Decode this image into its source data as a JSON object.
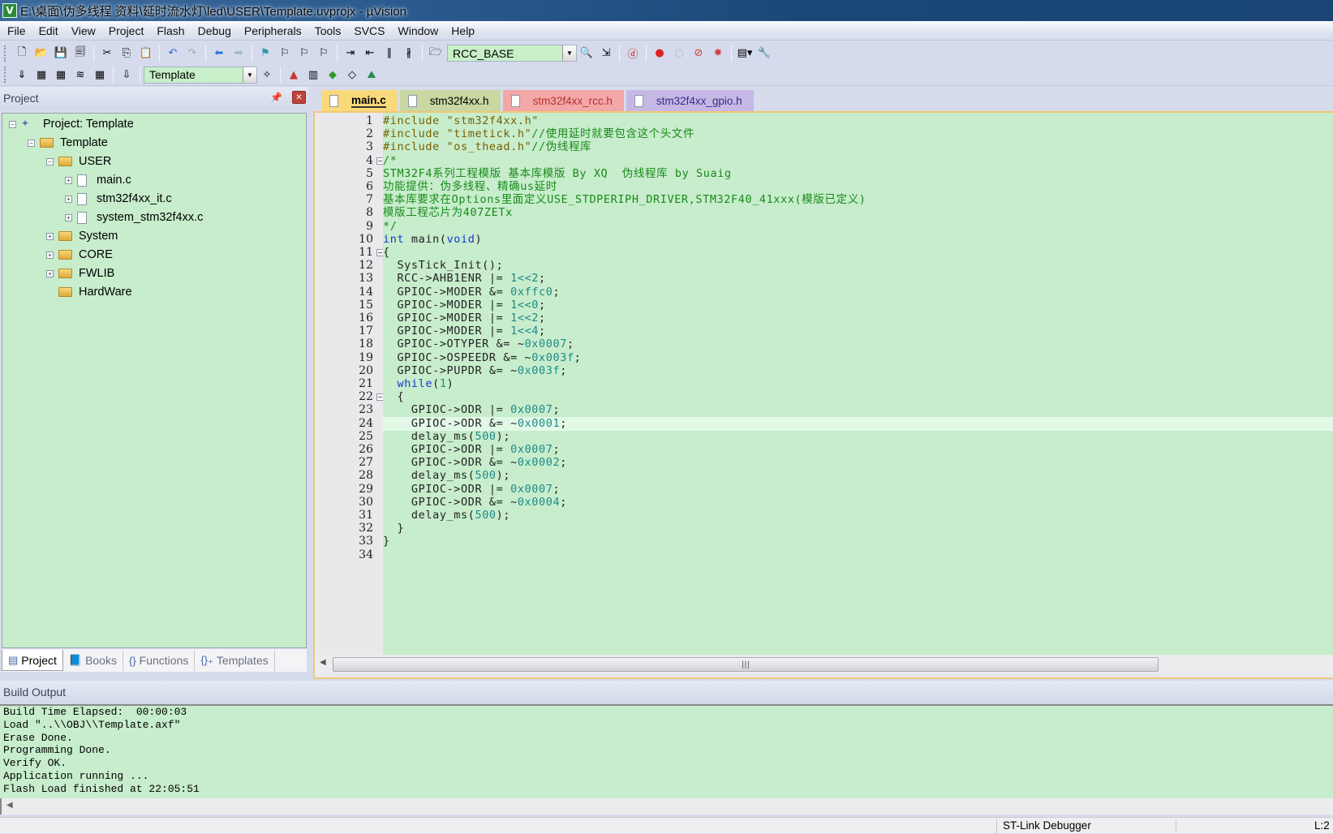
{
  "window": {
    "title": "E:\\桌面\\伪多线程 资料\\延时流水灯\\led\\USER\\Template.uvprojx - µVision",
    "app_icon": "uvision-icon"
  },
  "menu": [
    "File",
    "Edit",
    "View",
    "Project",
    "Flash",
    "Debug",
    "Peripherals",
    "Tools",
    "SVCS",
    "Window",
    "Help"
  ],
  "toolbar1": {
    "groups": [
      [
        "new-file-icon",
        "open-file-icon",
        "save-icon",
        "save-all-icon"
      ],
      [
        "cut-icon",
        "copy-icon",
        "paste-icon"
      ],
      [
        "undo-icon",
        "redo-icon"
      ],
      [
        "nav-back-icon",
        "nav-forward-icon"
      ],
      [
        "bookmark-icon",
        "prev-bookmark-icon",
        "next-bookmark-icon",
        "clear-bookmarks-icon"
      ],
      [
        "indent-icon",
        "unindent-icon",
        "comment-icon",
        "uncomment-icon"
      ]
    ],
    "find_combo_value": "RCC_BASE",
    "after_combo": [
      "find-in-files-icon",
      "incremental-find-icon",
      "debug-session-icon",
      "breakpoint-icon",
      "disable-breakpoint-icon",
      "kill-breakpoints-icon",
      "kill-all-breakpoints-icon",
      "window-layout-icon",
      "configure-icon"
    ]
  },
  "toolbar2": {
    "buttons": [
      "translate-icon",
      "build-icon",
      "rebuild-icon",
      "batch-build-icon",
      "stop-build-icon",
      "load-icon"
    ],
    "target_combo_value": "Template",
    "after_combo": [
      "target-options-icon",
      "manage-components-icon",
      "select-packs-icon",
      "pack-installer-icon",
      "event-recorder-icon",
      "rte-icon"
    ]
  },
  "project_panel": {
    "title": "Project",
    "tree": [
      {
        "label": "Project: Template",
        "level": 0,
        "kind": "project",
        "expander": "-"
      },
      {
        "label": "Template",
        "level": 1,
        "kind": "target",
        "expander": "-"
      },
      {
        "label": "USER",
        "level": 2,
        "kind": "folder-open",
        "expander": "-"
      },
      {
        "label": "main.c",
        "level": 3,
        "kind": "file",
        "expander": "+"
      },
      {
        "label": "stm32f4xx_it.c",
        "level": 3,
        "kind": "file",
        "expander": "+"
      },
      {
        "label": "system_stm32f4xx.c",
        "level": 3,
        "kind": "file",
        "expander": "+"
      },
      {
        "label": "System",
        "level": 2,
        "kind": "folder",
        "expander": "+"
      },
      {
        "label": "CORE",
        "level": 2,
        "kind": "folder",
        "expander": "+"
      },
      {
        "label": "FWLIB",
        "level": 2,
        "kind": "folder",
        "expander": "+"
      },
      {
        "label": "HardWare",
        "level": 2,
        "kind": "folder-open",
        "expander": ""
      }
    ],
    "tabs": [
      {
        "label": "Project",
        "icon": "project-tab-icon",
        "active": true
      },
      {
        "label": "Books",
        "icon": "books-icon",
        "active": false
      },
      {
        "label": "Functions",
        "icon": "{}",
        "active": false
      },
      {
        "label": "Templates",
        "icon": "templates-icon",
        "active": false
      }
    ]
  },
  "editor": {
    "tabs": [
      {
        "label": "main.c",
        "active": true
      },
      {
        "label": "stm32f4xx.h",
        "active": false
      },
      {
        "label": "stm32f4xx_rcc.h",
        "active": false
      },
      {
        "label": "stm32f4xx_gpio.h",
        "active": false
      }
    ],
    "current_line": 24,
    "fold_lines": {
      "4": "-",
      "11": "-",
      "22": "-"
    },
    "lines": [
      [
        [
          "pp",
          "#include "
        ],
        [
          "st",
          "\"stm32f4xx.h\""
        ]
      ],
      [
        [
          "pp",
          "#include "
        ],
        [
          "st",
          "\"timetick.h\""
        ],
        [
          "cm",
          "//使用延时就要包含这个头文件"
        ]
      ],
      [
        [
          "pp",
          "#include "
        ],
        [
          "st",
          "\"os_thead.h\""
        ],
        [
          "cm",
          "//伪线程库"
        ]
      ],
      [
        [
          "cm",
          "/*"
        ]
      ],
      [
        [
          "cm",
          "STM32F4系列工程模版 基本库模版 By XQ  伪线程库 by Suaig"
        ]
      ],
      [
        [
          "cm",
          "功能提供：伪多线程、精确us延时"
        ]
      ],
      [
        [
          "cm",
          "基本库要求在Options里面定义USE_STDPERIPH_DRIVER,STM32F40_41xxx(模版已定义)"
        ]
      ],
      [
        [
          "cm",
          "模版工程芯片为407ZETx"
        ]
      ],
      [
        [
          "cm",
          "*/"
        ]
      ],
      [
        [
          "kw",
          "int"
        ],
        [
          "t",
          " main("
        ],
        [
          "kw",
          "void"
        ],
        [
          "t",
          ")"
        ]
      ],
      [
        [
          "t",
          "{"
        ]
      ],
      [
        [
          "t",
          "  SysTick_Init();"
        ]
      ],
      [
        [
          "t",
          "  RCC->AHB1ENR |= "
        ],
        [
          "nm",
          "1<<2"
        ],
        [
          "t",
          ";"
        ]
      ],
      [
        [
          "t",
          "  GPIOC->MODER &= "
        ],
        [
          "nm",
          "0xffc0"
        ],
        [
          "t",
          ";"
        ]
      ],
      [
        [
          "t",
          "  GPIOC->MODER |= "
        ],
        [
          "nm",
          "1<<0"
        ],
        [
          "t",
          ";"
        ]
      ],
      [
        [
          "t",
          "  GPIOC->MODER |= "
        ],
        [
          "nm",
          "1<<2"
        ],
        [
          "t",
          ";"
        ]
      ],
      [
        [
          "t",
          "  GPIOC->MODER |= "
        ],
        [
          "nm",
          "1<<4"
        ],
        [
          "t",
          ";"
        ]
      ],
      [
        [
          "t",
          "  GPIOC->OTYPER &= ~"
        ],
        [
          "nm",
          "0x0007"
        ],
        [
          "t",
          ";"
        ]
      ],
      [
        [
          "t",
          "  GPIOC->OSPEEDR &= ~"
        ],
        [
          "nm",
          "0x003f"
        ],
        [
          "t",
          ";"
        ]
      ],
      [
        [
          "t",
          "  GPIOC->PUPDR &= ~"
        ],
        [
          "nm",
          "0x003f"
        ],
        [
          "t",
          ";"
        ]
      ],
      [
        [
          "t",
          "  "
        ],
        [
          "kw",
          "while"
        ],
        [
          "t",
          "("
        ],
        [
          "nm",
          "1"
        ],
        [
          "t",
          ")"
        ]
      ],
      [
        [
          "t",
          "  {"
        ]
      ],
      [
        [
          "t",
          "    GPIOC->ODR |= "
        ],
        [
          "nm",
          "0x0007"
        ],
        [
          "t",
          ";"
        ]
      ],
      [
        [
          "t",
          "    GPIOC->ODR &= ~"
        ],
        [
          "nm",
          "0x0001"
        ],
        [
          "t",
          ";"
        ]
      ],
      [
        [
          "t",
          "    delay_ms("
        ],
        [
          "nm",
          "500"
        ],
        [
          "t",
          ");"
        ]
      ],
      [
        [
          "t",
          "    GPIOC->ODR |= "
        ],
        [
          "nm",
          "0x0007"
        ],
        [
          "t",
          ";"
        ]
      ],
      [
        [
          "t",
          "    GPIOC->ODR &= ~"
        ],
        [
          "nm",
          "0x0002"
        ],
        [
          "t",
          ";"
        ]
      ],
      [
        [
          "t",
          "    delay_ms("
        ],
        [
          "nm",
          "500"
        ],
        [
          "t",
          ");"
        ]
      ],
      [
        [
          "t",
          "    GPIOC->ODR |= "
        ],
        [
          "nm",
          "0x0007"
        ],
        [
          "t",
          ";"
        ]
      ],
      [
        [
          "t",
          "    GPIOC->ODR &= ~"
        ],
        [
          "nm",
          "0x0004"
        ],
        [
          "t",
          ";"
        ]
      ],
      [
        [
          "t",
          "    delay_ms("
        ],
        [
          "nm",
          "500"
        ],
        [
          "t",
          ");"
        ]
      ],
      [
        [
          "t",
          "  }"
        ]
      ],
      [
        [
          "t",
          "}"
        ]
      ],
      [
        [
          "t",
          ""
        ]
      ]
    ]
  },
  "build_output": {
    "title": "Build Output",
    "lines": [
      "Build Time Elapsed:  00:00:03",
      "Load \"..\\\\OBJ\\\\Template.axf\"",
      "Erase Done.",
      "Programming Done.",
      "Verify OK.",
      "Application running ...",
      "Flash Load finished at 22:05:51"
    ]
  },
  "status": {
    "debugger": "ST-Link Debugger",
    "position": "L:2"
  }
}
